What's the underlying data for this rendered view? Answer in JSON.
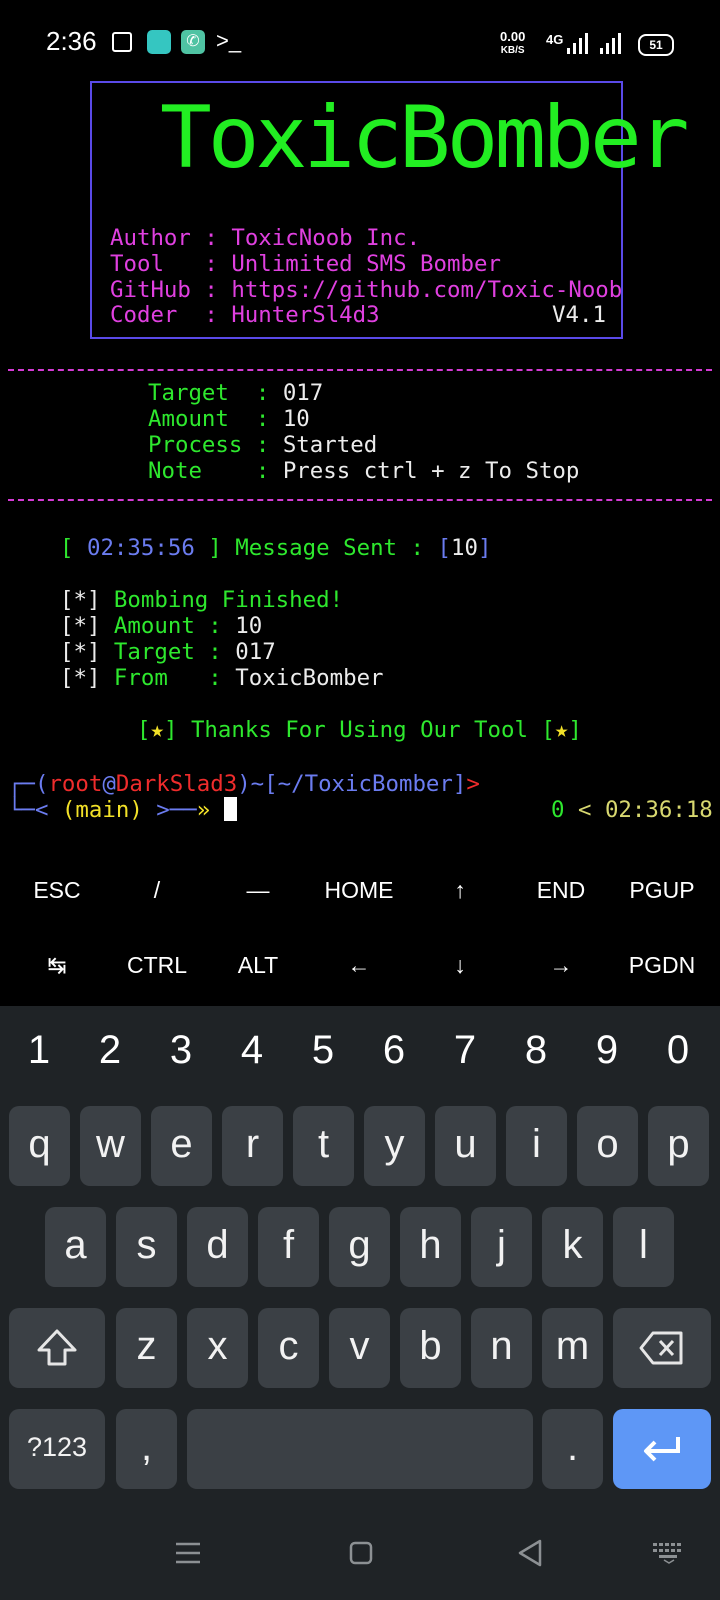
{
  "status_bar": {
    "time": "2:36",
    "net_speed_top": "0.00",
    "net_speed_bottom": "KB/S",
    "network": "4G",
    "battery": "51"
  },
  "banner": {
    "logo": "ToxicBomber",
    "author_label": "Author",
    "author_value": "ToxicNoob Inc.",
    "tool_label": "Tool",
    "tool_value": "Unlimited SMS Bomber",
    "github_label": "GitHub",
    "github_value": "https://github.com/Toxic-Noob",
    "coder_label": "Coder",
    "coder_value": "HunterSl4d3",
    "version": "V4.1"
  },
  "info": {
    "target_label": "Target",
    "target_value": "017",
    "amount_label": "Amount",
    "amount_value": "10",
    "process_label": "Process",
    "process_value": "Started",
    "note_label": "Note",
    "note_value": "Press ctrl + z To Stop"
  },
  "log": {
    "timestamp": "02:35:56",
    "message_label": "Message Sent :",
    "count": "10"
  },
  "summary": {
    "finished": "Bombing Finished!",
    "amount_label": "Amount",
    "amount_value": "10",
    "target_label": "Target",
    "target_value": "017",
    "from_label": "From",
    "from_value": "ToxicBomber",
    "thanks": "Thanks For Using Our Tool"
  },
  "prompt": {
    "user": "root",
    "host": "DarkSlad3",
    "path": "~/ToxicBomber",
    "branch": "main",
    "right_count": "0",
    "right_time": "02:36:18"
  },
  "extra_keys": {
    "row1": [
      "ESC",
      "/",
      "—",
      "HOME",
      "↑",
      "END",
      "PGUP"
    ],
    "row2": [
      "↹",
      "CTRL",
      "ALT",
      "←",
      "↓",
      "→",
      "PGDN"
    ]
  },
  "keyboard": {
    "numbers": [
      "1",
      "2",
      "3",
      "4",
      "5",
      "6",
      "7",
      "8",
      "9",
      "0"
    ],
    "row1": [
      "q",
      "w",
      "e",
      "r",
      "t",
      "y",
      "u",
      "i",
      "o",
      "p"
    ],
    "row2": [
      "a",
      "s",
      "d",
      "f",
      "g",
      "h",
      "j",
      "k",
      "l"
    ],
    "row3": [
      "z",
      "x",
      "c",
      "v",
      "b",
      "n",
      "m"
    ],
    "symbols_key": "?123",
    "comma": ",",
    "period": "."
  },
  "colors": {
    "accent_green": "#2ee82e",
    "magenta": "#e040e0",
    "enter_key": "#5e97f6"
  }
}
